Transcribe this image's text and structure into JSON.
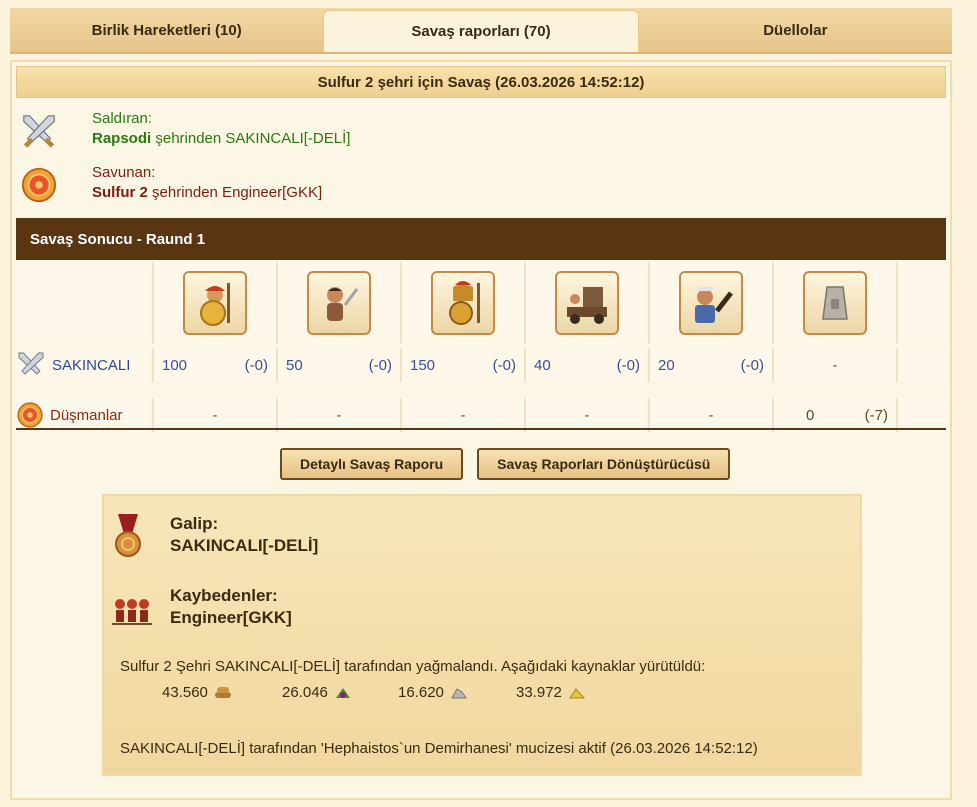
{
  "tabs": [
    {
      "label": "Birlik Hareketleri (10)"
    },
    {
      "label": "Savaş raporları (70)"
    },
    {
      "label": "Düellolar"
    }
  ],
  "battle": {
    "title": "Sulfur 2 şehri için Savaş (26.03.2026 14:52:12)",
    "attacker_label": "Saldıran:",
    "attacker_city": "Rapsodi",
    "attacker_suffix": " şehrinden SAKINCALI[-DELİ]",
    "defender_label": "Savunan:",
    "defender_city": "Sulfur 2",
    "defender_suffix": " şehrinden Engineer[GKK]"
  },
  "result_header": "Savaş Sonucu - Raund 1",
  "units": {
    "attacker_name": "SAKINCALI",
    "enemy_name": "Düşmanlar",
    "attacker_values": [
      {
        "v": "100",
        "l": "(-0)"
      },
      {
        "v": "50",
        "l": "(-0)"
      },
      {
        "v": "150",
        "l": "(-0)"
      },
      {
        "v": "40",
        "l": "(-0)"
      },
      {
        "v": "20",
        "l": "(-0)"
      },
      {
        "v": "-",
        "l": ""
      }
    ],
    "enemy_values": [
      {
        "v": "-",
        "l": ""
      },
      {
        "v": "-",
        "l": ""
      },
      {
        "v": "-",
        "l": ""
      },
      {
        "v": "-",
        "l": ""
      },
      {
        "v": "-",
        "l": ""
      },
      {
        "v": "0",
        "l": "(-7)"
      }
    ]
  },
  "buttons": {
    "detail": "Detaylı Savaş Raporu",
    "converter": "Savaş Raporları Dönüştürücüsü"
  },
  "summary": {
    "winner_label": "Galip:",
    "winner": "SAKINCALI[-DELİ]",
    "losers_label": "Kaybedenler:",
    "losers": "Engineer[GKK]",
    "loot_text": "Sulfur 2 Şehri SAKINCALI[-DELİ] tarafından yağmalandı. Aşağıdaki kaynaklar yürütüldü:",
    "resources": [
      {
        "amount": "43.560",
        "icon": "wood-icon"
      },
      {
        "amount": "26.046",
        "icon": "wine-icon"
      },
      {
        "amount": "16.620",
        "icon": "marble-icon"
      },
      {
        "amount": "33.972",
        "icon": "sulfur-icon"
      }
    ],
    "wonder_text": "SAKINCALI[-DELİ] tarafından 'Hephaistos`un Demirhanesi' mucizesi aktif (26.03.2026 14:52:12)"
  },
  "colors": {
    "header_dark": "#5a3512",
    "attacker_green": "#2a7a12",
    "defender_red": "#7a1f12",
    "unit_blue": "#3e4d9a"
  }
}
